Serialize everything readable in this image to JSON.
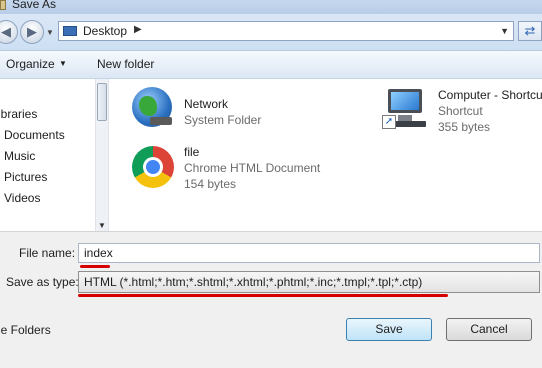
{
  "window": {
    "title": "Save As"
  },
  "nav": {
    "back_icon": "back-arrow-icon",
    "forward_icon": "forward-arrow-icon",
    "address": "Desktop",
    "refresh_icon": "refresh-icon"
  },
  "toolbar": {
    "organize": "Organize",
    "new_folder": "New folder"
  },
  "sidebar": {
    "items": [
      "ibraries",
      "Documents",
      "Music",
      "Pictures",
      "Videos"
    ]
  },
  "files": [
    {
      "name": "Network",
      "type": "System Folder",
      "size": "",
      "icon": "network-globe-icon"
    },
    {
      "name": "file",
      "type": "Chrome HTML Document",
      "size": "154 bytes",
      "icon": "chrome-icon"
    },
    {
      "name": "Computer - Shortcu",
      "type": "Shortcut",
      "size": "355 bytes",
      "icon": "computer-shortcut-icon"
    }
  ],
  "form": {
    "file_name_label": "File name:",
    "file_name_value": "index",
    "save_type_label": "Save as type:",
    "save_type_value": "HTML (*.html;*.htm;*.shtml;*.xhtml;*.phtml;*.inc;*.tmpl;*.tpl;*.ctp)"
  },
  "footer": {
    "hide_folders": "le Folders",
    "save": "Save",
    "cancel": "Cancel"
  },
  "colors": {
    "annotation_red": "#d60000",
    "save_button_border": "#3c7fb1"
  }
}
